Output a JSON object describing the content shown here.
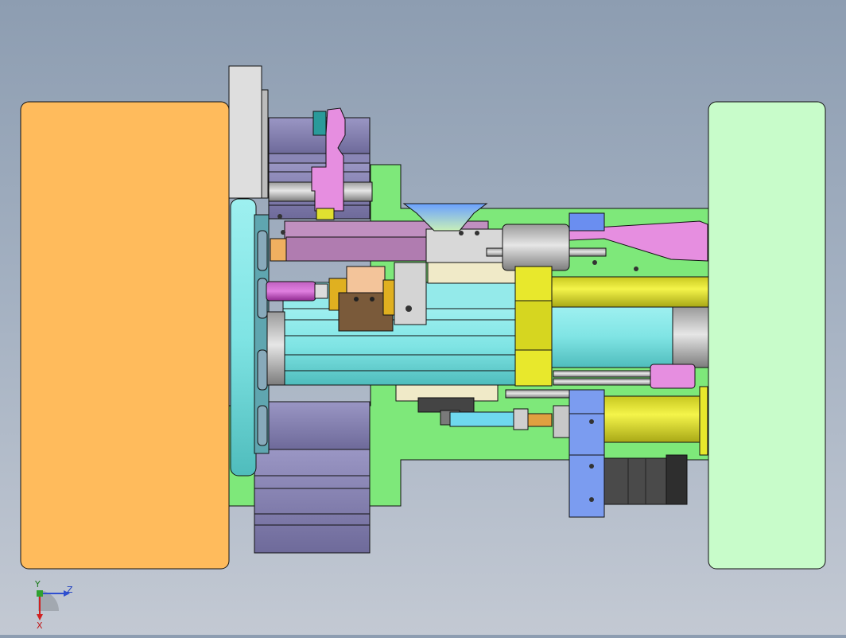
{
  "viewport": {
    "background_top": "#8d9db1",
    "background_bottom": "#c3c9d3"
  },
  "colors": {
    "left_plate": "#ffbb5c",
    "right_plate": "#c8fcca",
    "green_base": "#7ee87a",
    "cyan_body": "#7fe4e4",
    "yellow_cylinder": "#e0e030",
    "pink_arm": "#e68ee0",
    "purple_block": "#8a86b6",
    "blue_bracket": "#7b9cf0",
    "motor_dark": "#4a4a4a",
    "outline": "#111111"
  },
  "triad": {
    "axis_z_label": "Z",
    "axis_y_label": "Y",
    "axis_x_label": "X",
    "icon": "coordinate-triad-icon"
  }
}
